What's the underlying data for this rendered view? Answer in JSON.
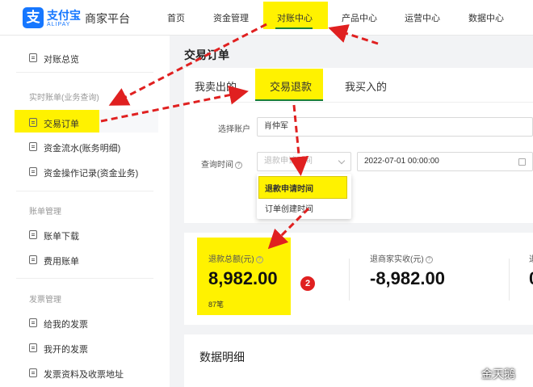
{
  "header": {
    "logo_char": "支",
    "brand_cn": "支付宝",
    "brand_en": "ALIPAY",
    "platform": "商家平台",
    "nav": [
      {
        "label": "首页"
      },
      {
        "label": "资金管理"
      },
      {
        "label": "对账中心"
      },
      {
        "label": "产品中心"
      },
      {
        "label": "运营中心"
      },
      {
        "label": "数据中心"
      }
    ],
    "active_nav": "对账中心"
  },
  "sidebar": {
    "overview": "对账总览",
    "section_realtime": "实时账单(业务查询)",
    "realtime_items": [
      {
        "label": "交易订单",
        "selected": true
      },
      {
        "label": "资金流水(账务明细)"
      },
      {
        "label": "资金操作记录(资金业务)"
      }
    ],
    "section_bill": "账单管理",
    "bill_items": [
      {
        "label": "账单下载"
      },
      {
        "label": "费用账单"
      }
    ],
    "section_invoice": "发票管理",
    "invoice_items": [
      {
        "label": "给我的发票"
      },
      {
        "label": "我开的发票"
      },
      {
        "label": "发票资料及收票地址"
      }
    ]
  },
  "main": {
    "title": "交易订单",
    "tabs": [
      {
        "label": "我卖出的"
      },
      {
        "label": "交易退款",
        "active": true
      },
      {
        "label": "我买入的"
      }
    ],
    "form": {
      "account_label": "选择账户",
      "account_value": "肖仲军",
      "time_label": "查询时间",
      "time_select_placeholder": "退款申请时间",
      "date_value": "2022-07-01 00:00:00"
    },
    "dropdown": {
      "options": [
        "退款申请时间",
        "订单创建时间"
      ],
      "selected": "退款申请时间"
    },
    "stats": [
      {
        "label": "退款总额(元)",
        "value": "8,982.00",
        "sub": "87笔"
      },
      {
        "label": "退商家实收(元)",
        "value": "-8,982.00"
      },
      {
        "label": "退",
        "value": "0"
      }
    ],
    "badge_number": "2",
    "section_title": "数据明细"
  },
  "watermark": "金天鹅",
  "colors": {
    "brand_blue": "#1677ff",
    "highlight_yellow": "#fff200",
    "active_green": "#1a7f37",
    "annotation_red": "#e02020"
  }
}
